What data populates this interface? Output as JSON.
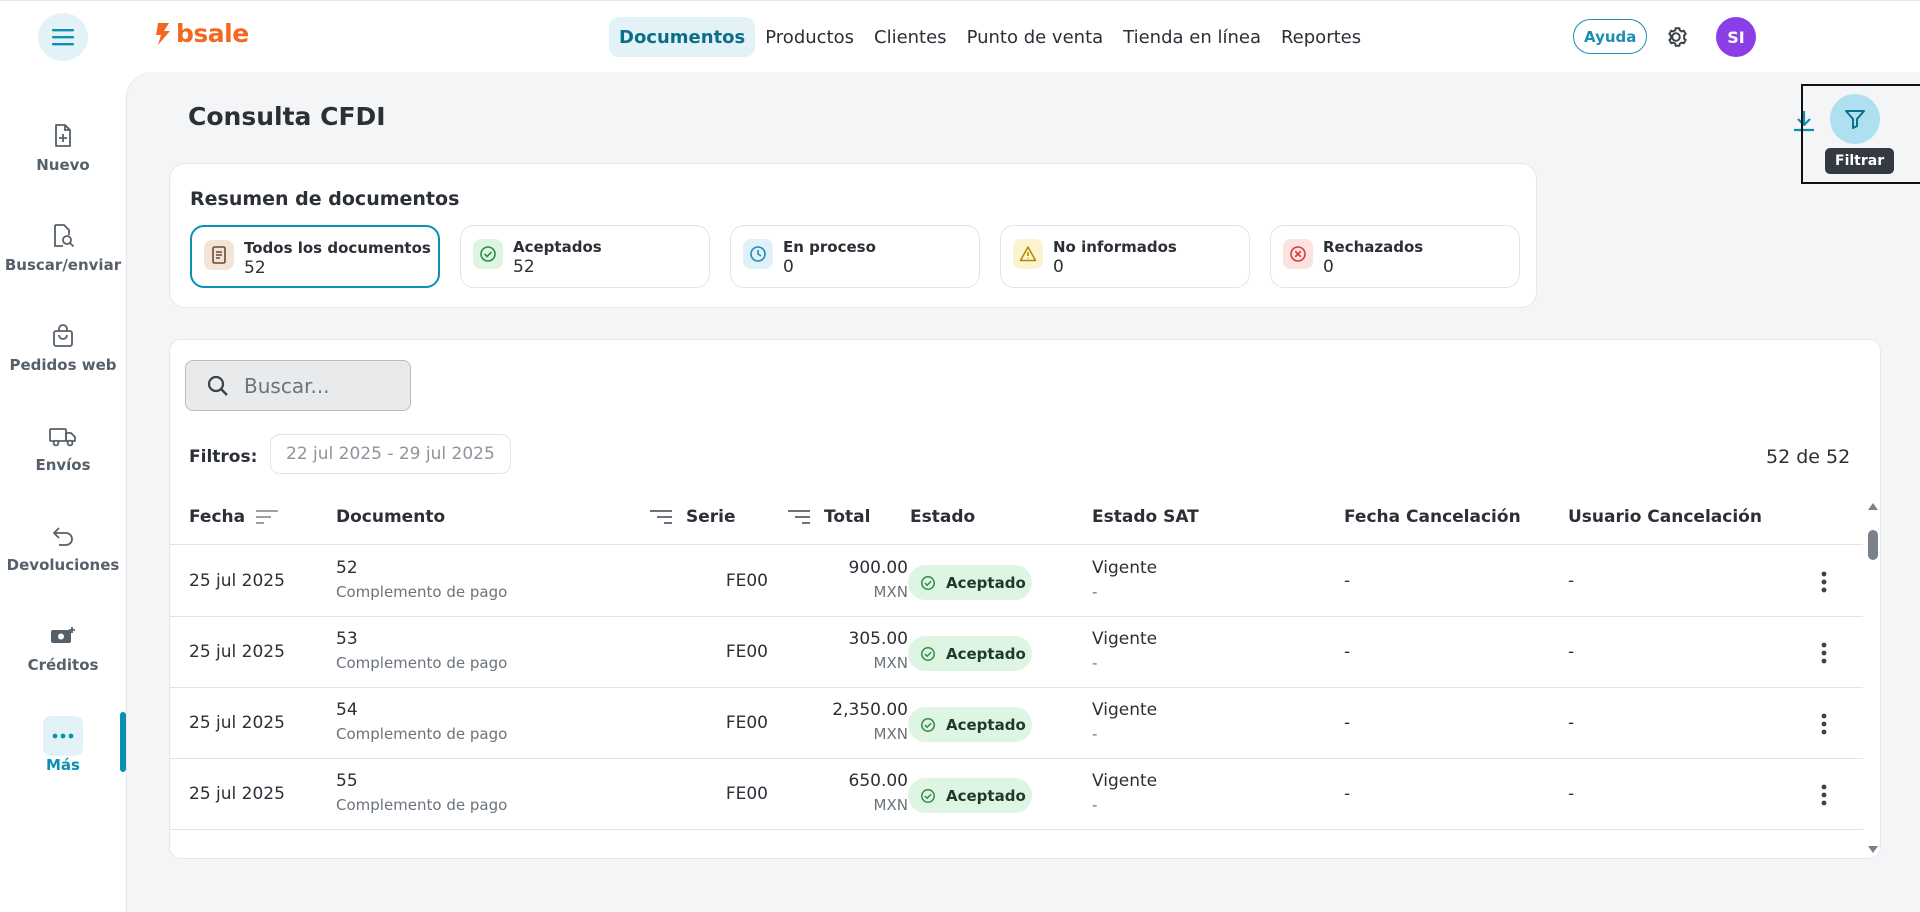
{
  "topbar": {
    "logo": "bsale",
    "nav": [
      "Documentos",
      "Productos",
      "Clientes",
      "Punto de venta",
      "Tienda en línea",
      "Reportes"
    ],
    "help": "Ayuda",
    "avatar": "SI"
  },
  "sidebar": {
    "items": [
      {
        "label": "Nuevo",
        "icon": "file-plus-icon"
      },
      {
        "label": "Buscar/enviar",
        "icon": "file-search-icon"
      },
      {
        "label": "Pedidos web",
        "icon": "shopping-bag-icon"
      },
      {
        "label": "Envíos",
        "icon": "truck-icon"
      },
      {
        "label": "Devoluciones",
        "icon": "return-arrow-icon"
      },
      {
        "label": "Créditos",
        "icon": "cash-plus-icon"
      },
      {
        "label": "Más",
        "icon": "more-dots-icon"
      }
    ]
  },
  "page": {
    "title": "Consulta CFDI",
    "tooltip": "Filtrar"
  },
  "summary": {
    "title": "Resumen de documentos",
    "stats": [
      {
        "label": "Todos los documentos",
        "count": "52"
      },
      {
        "label": "Aceptados",
        "count": "52"
      },
      {
        "label": "En proceso",
        "count": "0"
      },
      {
        "label": "No informados",
        "count": "0"
      },
      {
        "label": "Rechazados",
        "count": "0"
      }
    ]
  },
  "table": {
    "search_placeholder": "Buscar...",
    "filters_label": "Filtros:",
    "date_chip": "22 jul 2025 - 29 jul 2025",
    "count": "52 de 52",
    "headers": {
      "fecha": "Fecha",
      "documento": "Documento",
      "serie": "Serie",
      "total": "Total",
      "estado": "Estado",
      "estado_sat": "Estado SAT",
      "fecha_cancelacion": "Fecha Cancelación",
      "usuario_cancelacion": "Usuario Cancelación"
    },
    "rows": [
      {
        "fecha": "25 jul 2025",
        "numero": "52",
        "tipo": "Complemento de pago",
        "serie": "FE00",
        "total": "900.00",
        "moneda": "MXN",
        "estado": "Aceptado",
        "sat": "Vigente",
        "sat_sub": "-",
        "fecha_canc": "-",
        "usuario_canc": "-"
      },
      {
        "fecha": "25 jul 2025",
        "numero": "53",
        "tipo": "Complemento de pago",
        "serie": "FE00",
        "total": "305.00",
        "moneda": "MXN",
        "estado": "Aceptado",
        "sat": "Vigente",
        "sat_sub": "-",
        "fecha_canc": "-",
        "usuario_canc": "-"
      },
      {
        "fecha": "25 jul 2025",
        "numero": "54",
        "tipo": "Complemento de pago",
        "serie": "FE00",
        "total": "2,350.00",
        "moneda": "MXN",
        "estado": "Aceptado",
        "sat": "Vigente",
        "sat_sub": "-",
        "fecha_canc": "-",
        "usuario_canc": "-"
      },
      {
        "fecha": "25 jul 2025",
        "numero": "55",
        "tipo": "Complemento de pago",
        "serie": "FE00",
        "total": "650.00",
        "moneda": "MXN",
        "estado": "Aceptado",
        "sat": "Vigente",
        "sat_sub": "-",
        "fecha_canc": "-",
        "usuario_canc": "-"
      }
    ]
  },
  "colors": {
    "brand": "#f26722",
    "accent": "#0b8fb4",
    "avatar": "#8b3fe6",
    "success_bg": "#dff5e3"
  }
}
